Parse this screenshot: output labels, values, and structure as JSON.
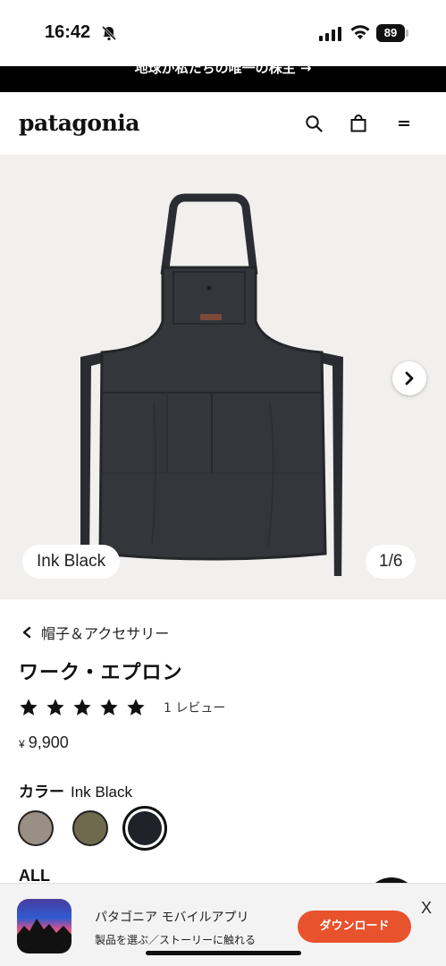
{
  "status_bar": {
    "time": "16:42",
    "battery": "89"
  },
  "promo": {
    "text": "地球が私たちの唯一の株主 →"
  },
  "header": {
    "logo": "patagonia",
    "icons": [
      "search-icon",
      "bag-icon",
      "menu-icon"
    ]
  },
  "hero": {
    "color_name": "Ink Black",
    "image_counter": "1/6"
  },
  "product": {
    "breadcrumb": "帽子＆アクセサリー",
    "title": "ワーク・エプロン",
    "rating": 5,
    "reviews": "1 レビュー",
    "currency": "¥",
    "price": "9,900",
    "color_label": "カラー",
    "color_value": "Ink Black",
    "swatches": [
      {
        "name": "light-taupe",
        "color": "#9a8f84"
      },
      {
        "name": "olive",
        "color": "#6f6a4e"
      },
      {
        "name": "ink-black",
        "color": "#1f2229",
        "selected": true
      }
    ],
    "size_label": "ALL"
  },
  "app_banner": {
    "title": "パタゴニア モバイルアプリ",
    "subtitle": "製品を選ぶ／ストーリーに触れる",
    "button": "ダウンロード",
    "close": "X"
  },
  "colors": {
    "accent": "#e8522c",
    "promo_bg": "#000000",
    "hero_bg": "#f1f0ee"
  }
}
